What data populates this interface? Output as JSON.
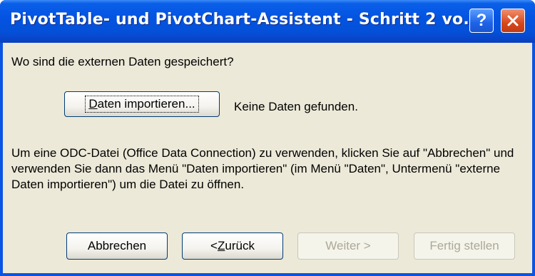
{
  "window": {
    "title": "PivotTable- und PivotChart-Assistent - Schritt 2 vo...",
    "help_label": "?",
    "close_icon": "close-icon"
  },
  "content": {
    "question": "Wo sind die externen Daten gespeichert?",
    "import_button": {
      "mnemonic": "D",
      "rest": "aten importieren..."
    },
    "status": "Keine Daten gefunden.",
    "info": "Um eine ODC-Datei (Office Data Connection) zu verwenden, klicken Sie auf \"Abbrechen\" und verwenden Sie dann das Menü \"Daten importieren\" (im Menü \"Daten\", Untermenü \"externe Daten importieren\") um die Datei zu öffnen."
  },
  "footer": {
    "cancel": "Abbrechen",
    "back": {
      "prefix": "< ",
      "mnemonic": "Z",
      "rest": "urück"
    },
    "next": "Weiter >",
    "finish": "Fertig stellen"
  },
  "colors": {
    "titlebar": "#0454e2",
    "dialog_bg": "#ece9d8",
    "close_button": "#d8481e"
  }
}
